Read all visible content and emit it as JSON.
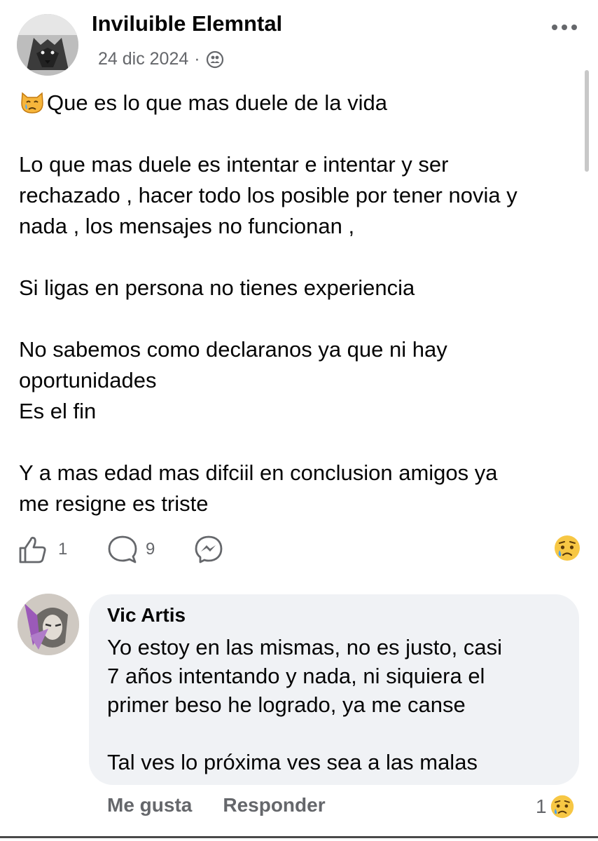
{
  "post": {
    "author": "Inviluible Elemntal",
    "date": "24 dic 2024",
    "separator": "·",
    "privacy_icon": "friends-icon",
    "emoji": "crying-cat-face",
    "body": "Que es lo que mas duele de la vida\n\nLo que mas duele es intentar e intentar y ser\nrechazado , hacer todo los posible por tener novia y\nnada , los mensajes no funcionan ,\n\nSi ligas en persona no tienes experiencia\n\nNo sabemos como declaranos ya que ni hay\noportunidades\nEs el fin\n\nY a mas edad mas difciil en conclusion amigos ya\nme resigne es triste"
  },
  "actions": {
    "like_count": "1",
    "comment_count": "9",
    "reaction": "sad-face-emoji"
  },
  "comment": {
    "author": "Vic Artis",
    "text": "Yo estoy en las mismas, no es justo, casi\n7 años intentando y nada, ni siquiera el\nprimer beso he logrado, ya me canse\n\nTal ves lo próxima ves sea a las malas",
    "like_label": "Me gusta",
    "reply_label": "Responder",
    "reaction_count": "1",
    "reaction": "sad-face-emoji"
  },
  "colors": {
    "secondary_text": "#65676b",
    "bubble_bg": "#f0f2f5",
    "primary_text": "#050505"
  }
}
